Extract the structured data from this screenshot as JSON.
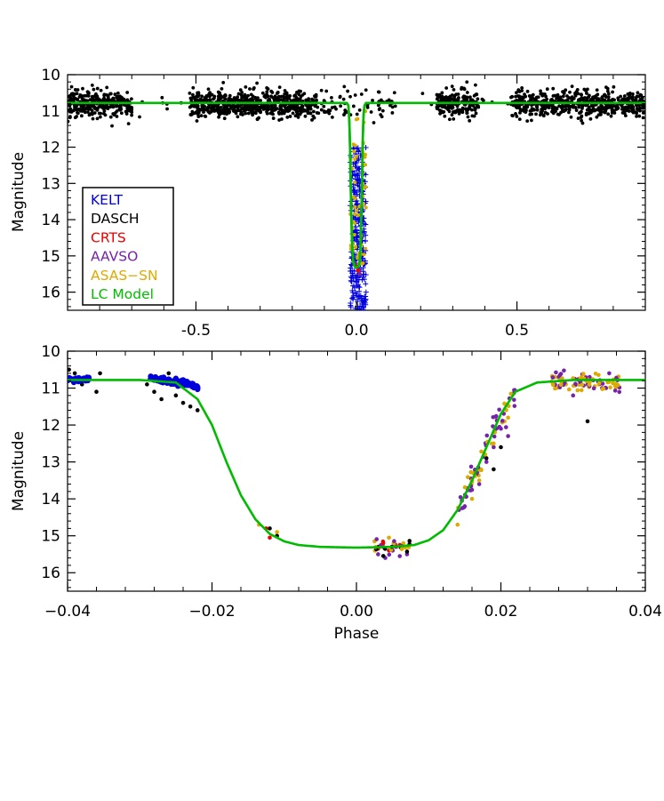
{
  "figure": {
    "top_panel": {
      "ylabel": "Magnitude",
      "xlim": [
        -0.9,
        0.9
      ],
      "ylim": [
        16.5,
        10
      ],
      "y_inverted": true,
      "xticks": [
        "-0.5",
        "0.0",
        "0.5"
      ],
      "xtick_values": [
        -0.5,
        0.0,
        0.5
      ],
      "yticks": [
        "10",
        "11",
        "12",
        "13",
        "14",
        "15",
        "16"
      ],
      "ytick_values": [
        10,
        11,
        12,
        13,
        14,
        15,
        16
      ],
      "legend_position": "lower-left",
      "legend": [
        {
          "label": "KELT",
          "color": "#0000dd"
        },
        {
          "label": "DASCH",
          "color": "#000000"
        },
        {
          "label": "CRTS",
          "color": "#ee0000"
        },
        {
          "label": "AAVSO",
          "color": "#7722aa"
        },
        {
          "label": "ASAS−SN",
          "color": "#ddaa00"
        },
        {
          "label": "LC Model",
          "color": "#00bb00"
        }
      ]
    },
    "bottom_panel": {
      "xlabel": "Phase",
      "ylabel": "Magnitude",
      "xlim": [
        -0.04,
        0.04
      ],
      "ylim": [
        16.5,
        10
      ],
      "y_inverted": true,
      "xticks": [
        "−0.04",
        "−0.02",
        "0.00",
        "0.02",
        "0.04"
      ],
      "xtick_values": [
        -0.04,
        -0.02,
        0.0,
        0.02,
        0.04
      ],
      "yticks": [
        "10",
        "11",
        "12",
        "13",
        "14",
        "15",
        "16"
      ],
      "ytick_values": [
        10,
        11,
        12,
        13,
        14,
        15,
        16
      ]
    }
  },
  "chart_data": [
    {
      "type": "scatter",
      "panel": "top",
      "x_range": [
        -0.9,
        0.9
      ],
      "y_range": [
        16.5,
        10
      ],
      "series": [
        {
          "name": "DASCH",
          "color": "#000000",
          "description_range": {
            "x": [
              -0.9,
              0.9
            ],
            "y_median": 10.8,
            "y_scatter": 0.3
          },
          "gaps": [
            [
              -0.7,
              -0.52
            ],
            [
              0.12,
              0.25
            ],
            [
              0.38,
              0.48
            ]
          ]
        },
        {
          "name": "KELT",
          "color": "#0000dd",
          "x": [
            -0.02,
            0.03
          ],
          "y": [
            11,
            16.5
          ]
        },
        {
          "name": "CRTS",
          "color": "#ee0000",
          "x": [
            -0.005,
            0.005
          ],
          "y": [
            15.0,
            15.5
          ]
        },
        {
          "name": "AAVSO",
          "color": "#7722aa",
          "x": [
            0.0,
            0.01
          ],
          "y": [
            15.2,
            15.5
          ]
        },
        {
          "name": "ASAS−SN",
          "color": "#ddaa00",
          "x": [
            0.0,
            0.03
          ],
          "y": [
            10.6,
            15.3
          ]
        },
        {
          "name": "LC Model",
          "color": "#00bb00",
          "baseline_mag": 10.78,
          "eclipse_depth_mag": 15.32
        }
      ]
    },
    {
      "type": "scatter",
      "panel": "bottom",
      "x_range": [
        -0.04,
        0.04
      ],
      "y_range": [
        16.5,
        10
      ],
      "model": {
        "name": "LC Model",
        "color": "#00bb00",
        "phase": [
          -0.04,
          -0.03,
          -0.025,
          -0.022,
          -0.02,
          -0.018,
          -0.016,
          -0.014,
          -0.012,
          -0.01,
          -0.008,
          -0.005,
          0.0,
          0.005,
          0.008,
          0.01,
          0.012,
          0.014,
          0.016,
          0.018,
          0.02,
          0.022,
          0.025,
          0.03,
          0.04
        ],
        "magnitude": [
          10.78,
          10.78,
          10.85,
          11.3,
          12.0,
          13.0,
          13.9,
          14.55,
          14.95,
          15.15,
          15.25,
          15.3,
          15.32,
          15.3,
          15.25,
          15.12,
          14.85,
          14.3,
          13.5,
          12.6,
          11.7,
          11.1,
          10.85,
          10.78,
          10.78
        ]
      },
      "series": [
        {
          "name": "KELT",
          "color": "#0000dd",
          "x": [
            -0.0395,
            -0.039,
            -0.0385,
            -0.038,
            -0.0375,
            -0.0285,
            -0.028,
            -0.027,
            -0.026,
            -0.025,
            -0.024,
            -0.0235,
            -0.023,
            -0.0225,
            -0.022
          ],
          "y": [
            10.75,
            10.8,
            10.82,
            10.78,
            10.8,
            10.75,
            10.78,
            10.72,
            10.76,
            10.74,
            10.78,
            10.82,
            10.88,
            10.95,
            11.0
          ]
        },
        {
          "name": "DASCH",
          "color": "#000000",
          "x": [
            -0.0398,
            -0.039,
            -0.038,
            -0.037,
            -0.036,
            -0.0355,
            -0.029,
            -0.028,
            -0.027,
            -0.026,
            -0.025,
            -0.024,
            -0.023,
            -0.022,
            -0.012,
            -0.011,
            0.003,
            0.005,
            0.018,
            0.019,
            0.02,
            0.032
          ],
          "y": [
            10.5,
            10.6,
            10.9,
            10.7,
            11.1,
            10.6,
            10.9,
            11.1,
            11.3,
            10.6,
            11.2,
            11.4,
            11.5,
            11.6,
            14.8,
            15.0,
            15.3,
            15.4,
            12.9,
            13.2,
            12.6,
            11.9
          ]
        },
        {
          "name": "CRTS",
          "color": "#ee0000",
          "x": [
            -0.0125,
            -0.012,
            0.003,
            0.0045,
            0.0055,
            0.006
          ],
          "y": [
            14.8,
            15.05,
            15.35,
            15.4,
            15.3,
            15.25
          ]
        },
        {
          "name": "AAVSO",
          "color": "#7722aa",
          "x": [
            0.003,
            0.004,
            0.005,
            0.006,
            0.007,
            0.015,
            0.017,
            0.018,
            0.019,
            0.02,
            0.021,
            0.028,
            0.03,
            0.032,
            0.034,
            0.035
          ],
          "y": [
            15.5,
            15.6,
            15.4,
            15.55,
            15.5,
            14.2,
            13.6,
            13.0,
            12.6,
            12.1,
            12.3,
            10.7,
            11.2,
            10.9,
            11.0,
            10.6
          ]
        },
        {
          "name": "ASAS−SN",
          "color": "#ddaa00",
          "x": [
            -0.0135,
            -0.011,
            0.0025,
            0.0045,
            0.0065,
            0.014,
            0.016,
            0.017,
            0.019,
            0.0205,
            0.021,
            0.0275,
            0.029,
            0.031,
            0.033,
            0.035,
            0.036
          ],
          "y": [
            14.7,
            14.9,
            15.15,
            15.05,
            15.2,
            14.7,
            14.0,
            13.5,
            12.5,
            11.9,
            11.8,
            10.7,
            10.9,
            10.85,
            10.95,
            10.8,
            10.9
          ]
        }
      ]
    }
  ]
}
